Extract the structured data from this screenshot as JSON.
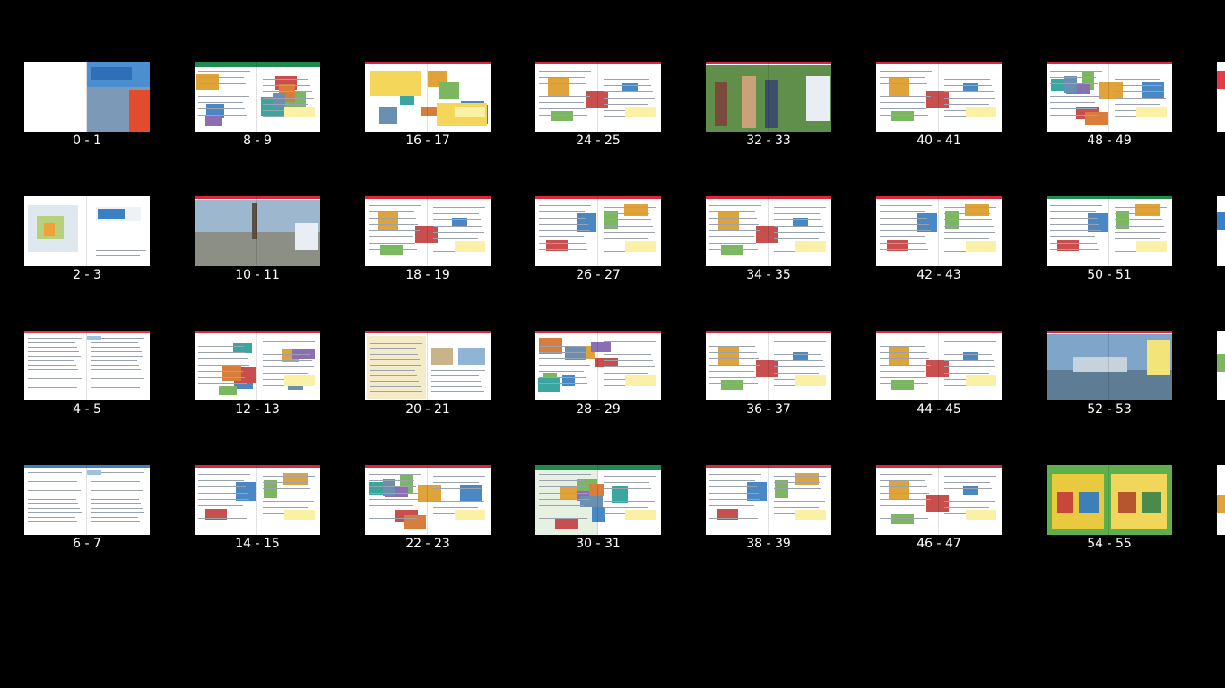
{
  "viewer": {
    "background": "#000000"
  },
  "spreads": [
    {
      "label": "0 - 1",
      "style": "cover",
      "accent": "#3b7fc4"
    },
    {
      "label": "2 - 3",
      "style": "titlepage",
      "accent": "#3b7fc4"
    },
    {
      "label": "4 - 5",
      "style": "toc",
      "accent": "#e53946"
    },
    {
      "label": "6 - 7",
      "style": "toc",
      "accent": "#3b7fc4"
    },
    {
      "label": "8 - 9",
      "style": "collage",
      "accent": "#1f8a4c"
    },
    {
      "label": "10 - 11",
      "style": "photo-city",
      "accent": "#d8283a"
    },
    {
      "label": "12 - 13",
      "style": "map-collage",
      "accent": "#d8283a"
    },
    {
      "label": "14 - 15",
      "style": "text",
      "accent": "#d8283a"
    },
    {
      "label": "16 - 17",
      "style": "boxes",
      "accent": "#d8283a"
    },
    {
      "label": "18 - 19",
      "style": "text-photo",
      "accent": "#d8283a"
    },
    {
      "label": "20 - 21",
      "style": "cream",
      "accent": "#d8283a"
    },
    {
      "label": "22 - 23",
      "style": "collage-text",
      "accent": "#d8283a"
    },
    {
      "label": "24 - 25",
      "style": "text-photo",
      "accent": "#d8283a"
    },
    {
      "label": "26 - 27",
      "style": "text",
      "accent": "#d8283a"
    },
    {
      "label": "28 - 29",
      "style": "photo-mix",
      "accent": "#d8283a"
    },
    {
      "label": "30 - 31",
      "style": "green-collage",
      "accent": "#1f8a4c"
    },
    {
      "label": "32 - 33",
      "style": "photo-people",
      "accent": "#d8283a"
    },
    {
      "label": "34 - 35",
      "style": "text-photo",
      "accent": "#d8283a"
    },
    {
      "label": "36 - 37",
      "style": "text-photo",
      "accent": "#d8283a"
    },
    {
      "label": "38 - 39",
      "style": "text",
      "accent": "#d8283a"
    },
    {
      "label": "40 - 41",
      "style": "text-photo",
      "accent": "#d8283a"
    },
    {
      "label": "42 - 43",
      "style": "text",
      "accent": "#d8283a"
    },
    {
      "label": "44 - 45",
      "style": "text-photo",
      "accent": "#d8283a"
    },
    {
      "label": "46 - 47",
      "style": "text-photo",
      "accent": "#d8283a"
    },
    {
      "label": "48 - 49",
      "style": "collage-text",
      "accent": "#d8283a"
    },
    {
      "label": "50 - 51",
      "style": "text",
      "accent": "#1f8a4c"
    },
    {
      "label": "52 - 53",
      "style": "photo-landscape",
      "accent": "#d8283a"
    },
    {
      "label": "54 - 55",
      "style": "green-poster",
      "accent": "#1f8a4c"
    }
  ]
}
